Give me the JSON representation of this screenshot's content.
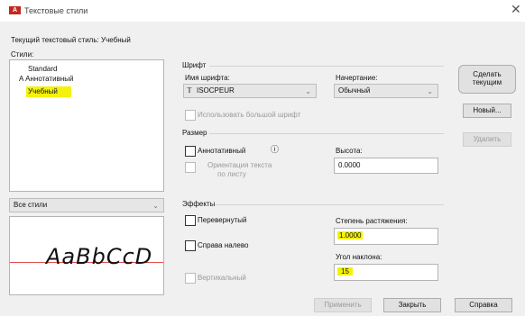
{
  "window": {
    "title": "Текстовые стили",
    "close_glyph": "✕"
  },
  "current_style": {
    "label": "Текущий текстовый стиль:",
    "value": "Учебный"
  },
  "styles": {
    "label": "Стили:",
    "items": [
      {
        "label": "Standard",
        "prefix": ""
      },
      {
        "label": "Аннотативный",
        "prefix": "A"
      },
      {
        "label": "Учебный",
        "prefix": ""
      }
    ],
    "selected": "Учебный",
    "filter": {
      "value": "Все стили",
      "icon": "chevron-down-icon"
    }
  },
  "preview": {
    "text": "AaBbCcD"
  },
  "font": {
    "group_label": "Шрифт",
    "name_label": "Имя шрифта:",
    "name_value": "ISOCPEUR",
    "name_icon": "truetype-font-icon",
    "style_label": "Начертание:",
    "style_value": "Обычный",
    "bigfont_label": "Использовать большой шрифт"
  },
  "size": {
    "group_label": "Размер",
    "annotative_label": "Аннотативный",
    "info_icon": "info-icon",
    "match_orientation_label_1": "Ориентация текста",
    "match_orientation_label_2": "по листу",
    "height_label": "Высота:",
    "height_value": "0.0000"
  },
  "effects": {
    "group_label": "Эффекты",
    "upside_down_label": "Перевернутый",
    "backwards_label": "Справа налево",
    "vertical_label": "Вертикальный",
    "width_factor_label": "Степень растяжения:",
    "width_factor_value": "1.0000",
    "oblique_label": "Угол наклона:",
    "oblique_value": "15"
  },
  "buttons": {
    "set_current": [
      "Сделать",
      "текущим"
    ],
    "new": "Новый...",
    "delete": "Удалить",
    "apply": "Применить",
    "close": "Закрыть",
    "help": "Справка"
  },
  "colors": {
    "highlight": "#f4f20a",
    "selection": "#3b7bd4",
    "preview_baseline": "#e05050"
  }
}
